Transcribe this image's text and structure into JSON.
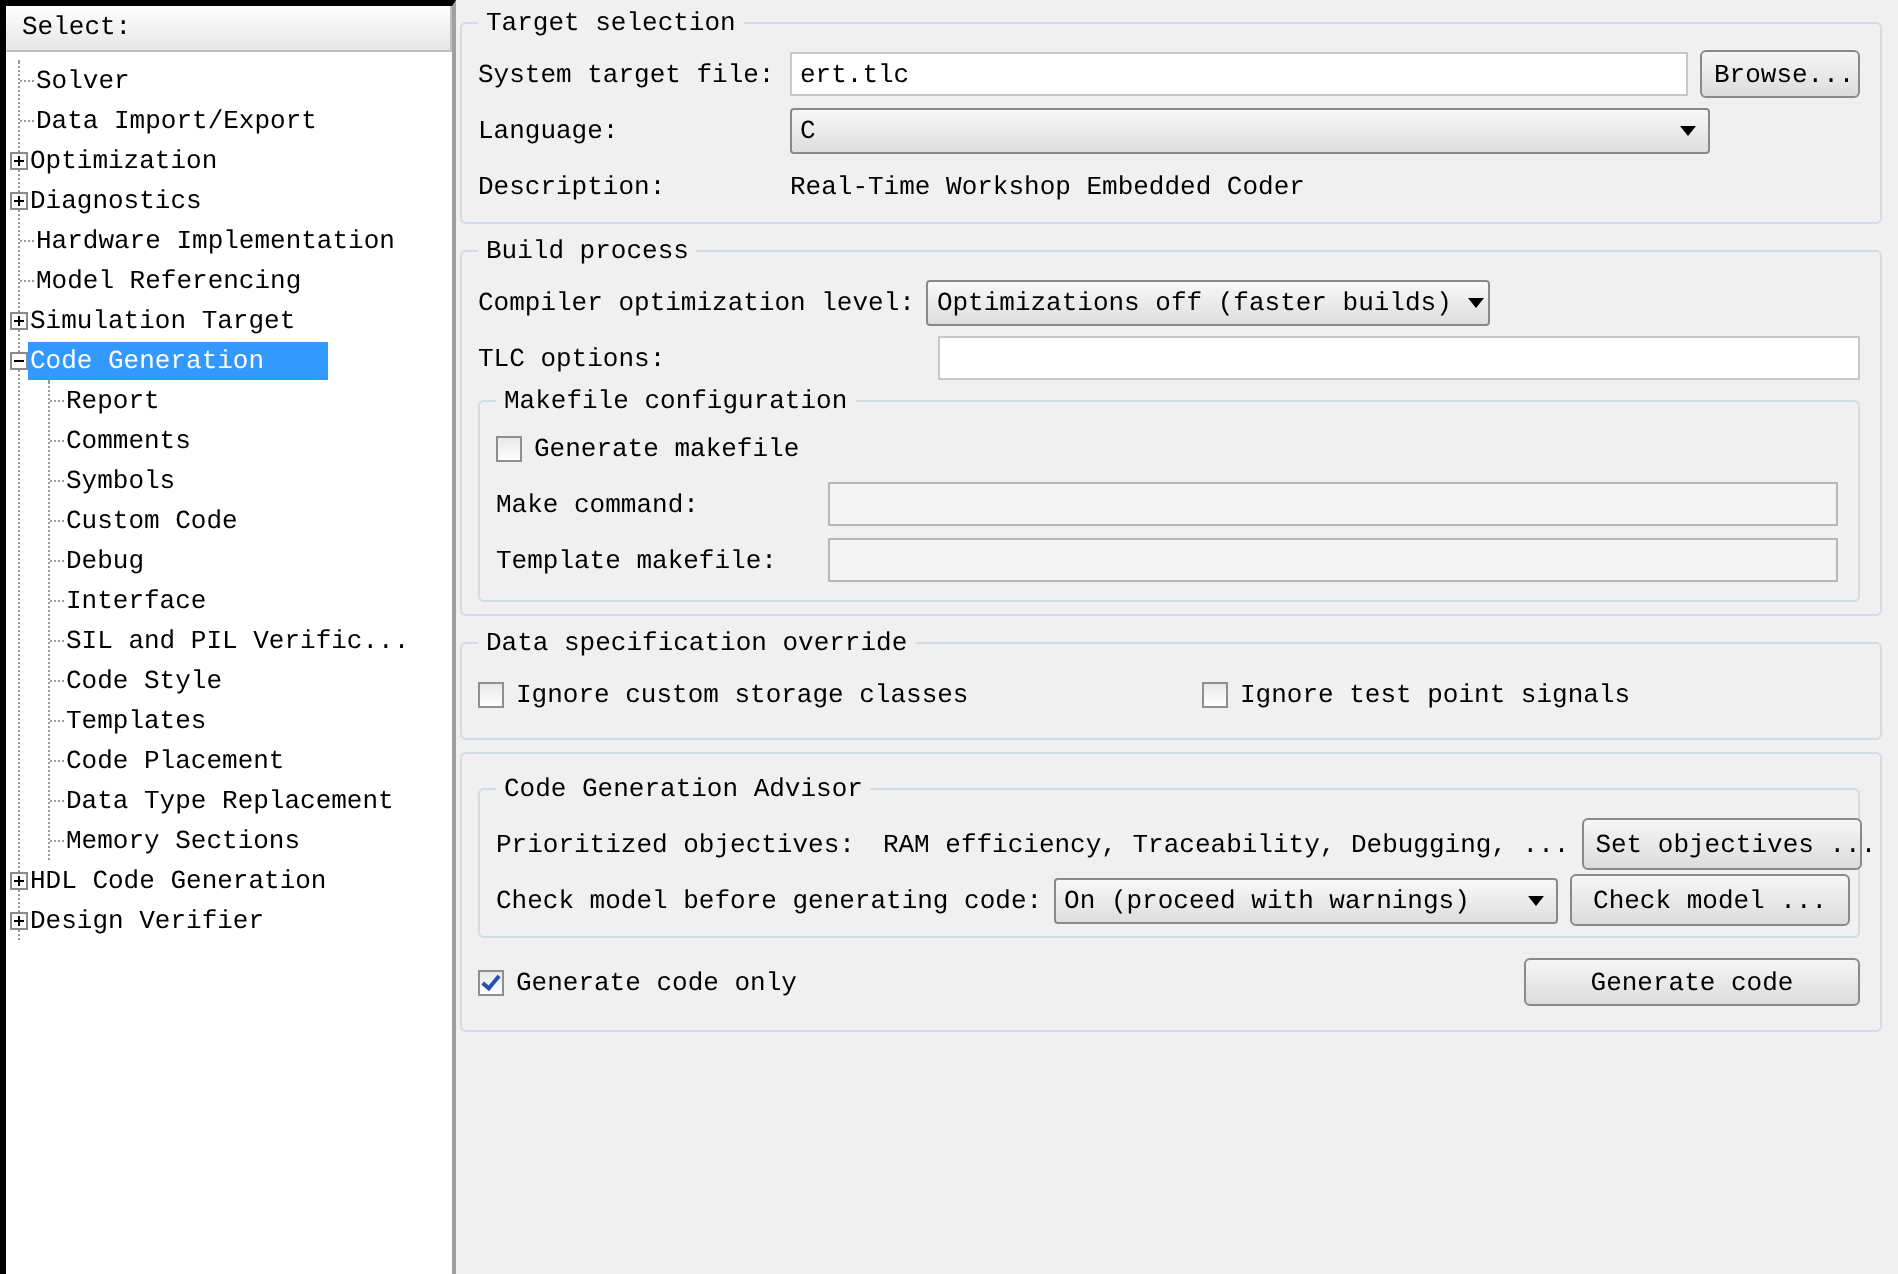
{
  "sidebar": {
    "header": "Select:",
    "items": [
      {
        "label": "Solver",
        "selected": false
      },
      {
        "label": "Data Import/Export",
        "selected": false
      },
      {
        "label": "Optimization",
        "selected": false,
        "expanded": false
      },
      {
        "label": "Diagnostics",
        "selected": false,
        "expanded": false
      },
      {
        "label": "Hardware Implementation",
        "selected": false
      },
      {
        "label": "Model Referencing",
        "selected": false
      },
      {
        "label": "Simulation Target",
        "selected": false,
        "expanded": false
      },
      {
        "label": "Code Generation",
        "selected": true,
        "expanded": true,
        "children": [
          {
            "label": "Report",
            "selected": false
          },
          {
            "label": "Comments",
            "selected": false
          },
          {
            "label": "Symbols",
            "selected": false
          },
          {
            "label": "Custom Code",
            "selected": false
          },
          {
            "label": "Debug",
            "selected": false
          },
          {
            "label": "Interface",
            "selected": false
          },
          {
            "label": "SIL and PIL Verific...",
            "selected": false
          },
          {
            "label": "Code Style",
            "selected": false
          },
          {
            "label": "Templates",
            "selected": false
          },
          {
            "label": "Code Placement",
            "selected": false
          },
          {
            "label": "Data Type Replacement",
            "selected": false
          },
          {
            "label": "Memory Sections",
            "selected": false
          }
        ]
      },
      {
        "label": "HDL Code Generation",
        "selected": false,
        "expanded": false
      },
      {
        "label": "Design Verifier",
        "selected": false,
        "expanded": false
      }
    ]
  },
  "target_selection": {
    "title": "Target selection",
    "system_target_file": {
      "label": "System target file:",
      "value": "ert.tlc"
    },
    "browse_button": "Browse...",
    "language": {
      "label": "Language:",
      "value": "C"
    },
    "description": {
      "label": "Description:",
      "value": "Real-Time Workshop Embedded Coder"
    }
  },
  "build_process": {
    "title": "Build process",
    "compiler_optimization": {
      "label": "Compiler optimization level:",
      "value": "Optimizations off (faster builds)"
    },
    "tlc_options": {
      "label": "TLC options:"
    },
    "makefile": {
      "title": "Makefile configuration",
      "generate_makefile": {
        "label": "Generate makefile",
        "checked": false
      },
      "make_command": {
        "label": "Make command:",
        "disabled": true
      },
      "template_makefile": {
        "label": "Template makefile:",
        "disabled": true
      }
    }
  },
  "data_specification": {
    "title": "Data specification override",
    "options": [
      {
        "label": "Ignore custom storage classes",
        "checked": false
      },
      {
        "label": "Ignore test point signals",
        "checked": false
      }
    ]
  },
  "advisor": {
    "title": "Code Generation Advisor",
    "objectives": {
      "label": "Prioritized objectives:",
      "value": "RAM efficiency, Traceability, Debugging, ..."
    },
    "set_objectives_button": "Set objectives ...",
    "check_model": {
      "label": "Check model before generating code:",
      "value": "On (proceed with warnings)"
    },
    "check_model_button": "Check model ..."
  },
  "generate_code_only": {
    "label": "Generate code only",
    "checked": true
  },
  "generate_code_button": "Generate code"
}
